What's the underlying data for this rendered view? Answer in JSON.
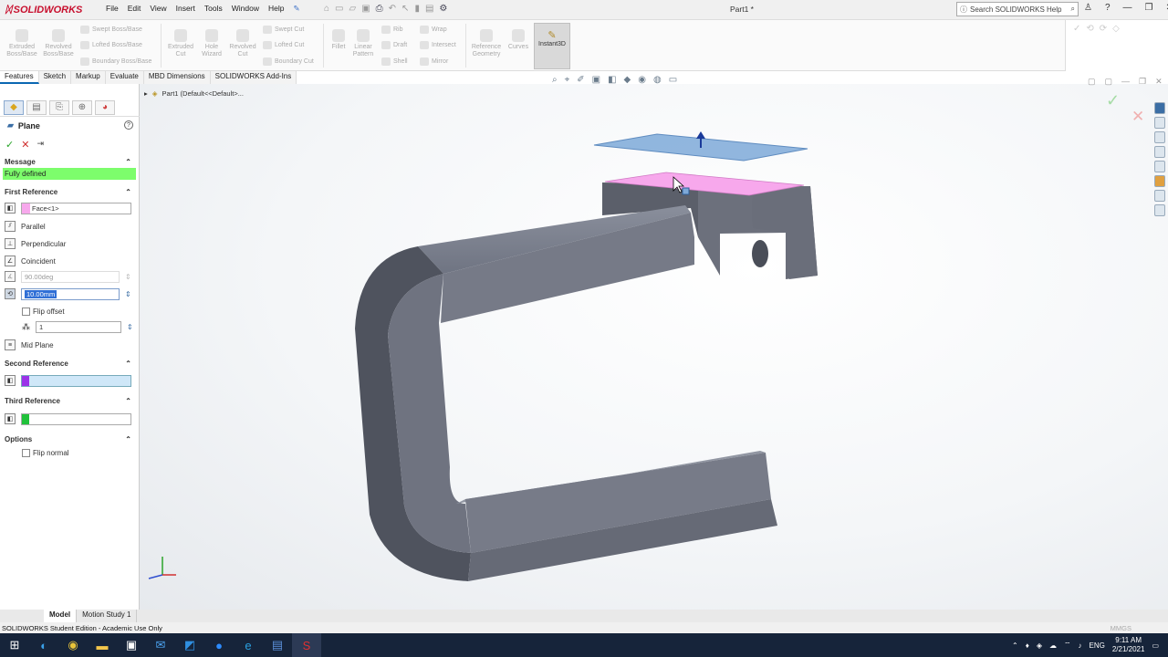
{
  "app": {
    "name": "SOLIDWORKS",
    "doc_title": "Part1 *"
  },
  "menu": [
    "File",
    "Edit",
    "View",
    "Insert",
    "Tools",
    "Window",
    "Help"
  ],
  "search": {
    "placeholder": "Search SOLIDWORKS Help"
  },
  "ribbon": {
    "large": [
      {
        "label": "Extruded Boss/Base"
      },
      {
        "label": "Revolved Boss/Base"
      },
      {
        "label": "Extruded Cut"
      },
      {
        "label": "Hole Wizard"
      },
      {
        "label": "Revolved Cut"
      },
      {
        "label": "Fillet"
      },
      {
        "label": "Linear Pattern"
      },
      {
        "label": "Reference Geometry"
      },
      {
        "label": "Curves"
      }
    ],
    "small": [
      "Swept Boss/Base",
      "Lofted Boss/Base",
      "Boundary Boss/Base",
      "Swept Cut",
      "Lofted Cut",
      "Boundary Cut",
      "Rib",
      "Draft",
      "Shell",
      "Wrap",
      "Intersect",
      "Mirror"
    ],
    "instant3d": "Instant3D"
  },
  "tabs": [
    "Features",
    "Sketch",
    "Markup",
    "Evaluate",
    "MBD Dimensions",
    "SOLIDWORKS Add-Ins"
  ],
  "tree": {
    "root": "Part1  (Default<<Default>..."
  },
  "pm": {
    "title": "Plane",
    "help": "?",
    "message_header": "Message",
    "message": "Fully defined",
    "first_ref": {
      "header": "First Reference",
      "face": "Face<1>",
      "options": [
        "Parallel",
        "Perpendicular",
        "Coincident"
      ],
      "angle": "90.00deg",
      "distance": "10.00mm",
      "flip_offset": "Flip offset",
      "count": "1",
      "mid_plane": "Mid Plane"
    },
    "second_ref": {
      "header": "Second Reference"
    },
    "third_ref": {
      "header": "Third Reference"
    },
    "options": {
      "header": "Options",
      "flip_normal": "Flip normal"
    }
  },
  "bottom_tabs": [
    "Model",
    "Motion Study 1"
  ],
  "status": {
    "left": "SOLIDWORKS Student Edition - Academic Use Only",
    "units": "MMGS"
  },
  "taskbar": {
    "time": "9:11 AM",
    "date": "2/21/2021",
    "lang": "ENG"
  },
  "colors": {
    "accent": "#0a67b2",
    "message_bg": "#7dfd6c",
    "face_highlight": "#f7a8ec",
    "plane_preview": "#7ea9d8",
    "part": "#6e7380"
  }
}
